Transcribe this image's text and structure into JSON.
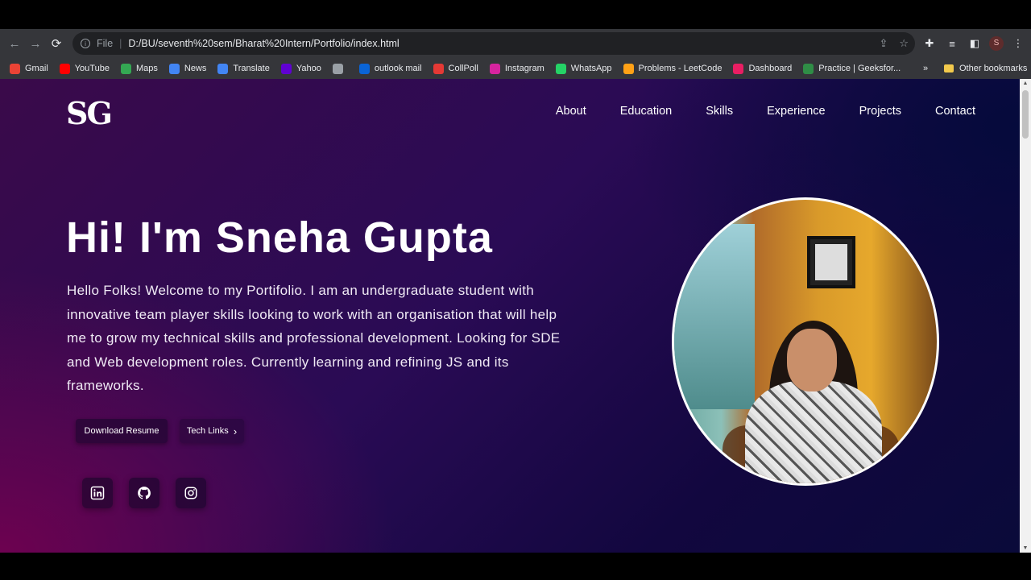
{
  "browser": {
    "url_scheme": "File",
    "url": "D:/BU/seventh%20sem/Bharat%20Intern/Portfolio/index.html",
    "profile_initial": "S",
    "bookmarks": [
      {
        "label": "Gmail",
        "icon": "gmail-icon",
        "color": "#ea4335"
      },
      {
        "label": "YouTube",
        "icon": "youtube-icon",
        "color": "#ff0000"
      },
      {
        "label": "Maps",
        "icon": "maps-icon",
        "color": "#34a853"
      },
      {
        "label": "News",
        "icon": "news-icon",
        "color": "#4285f4"
      },
      {
        "label": "Translate",
        "icon": "translate-icon",
        "color": "#4285f4"
      },
      {
        "label": "Yahoo",
        "icon": "yahoo-icon",
        "color": "#6001d2"
      },
      {
        "label": "",
        "icon": "globe-icon",
        "color": "#9aa0a6"
      },
      {
        "label": "outlook mail",
        "icon": "outlook-icon",
        "color": "#0a64d6"
      },
      {
        "label": "CollPoll",
        "icon": "collpoll-icon",
        "color": "#e53935"
      },
      {
        "label": "Instagram",
        "icon": "instagram-icon",
        "color": "#d6249f"
      },
      {
        "label": "WhatsApp",
        "icon": "whatsapp-icon",
        "color": "#25d366"
      },
      {
        "label": "Problems - LeetCode",
        "icon": "leetcode-icon",
        "color": "#ffa116"
      },
      {
        "label": "Dashboard",
        "icon": "dashboard-icon",
        "color": "#e91e63"
      },
      {
        "label": "Practice | Geeksfor...",
        "icon": "gfg-icon",
        "color": "#2f8d46"
      }
    ],
    "more_bookmarks": "»",
    "other_bookmarks": "Other bookmarks"
  },
  "site": {
    "logo": "SG",
    "nav": [
      "About",
      "Education",
      "Skills",
      "Experience",
      "Projects",
      "Contact"
    ],
    "hero_title": "Hi! I'm Sneha Gupta",
    "hero_text": "Hello Folks! Welcome to my Portifolio. I am an undergraduate student with innovative team player skills looking to work with an organisation that will help me to grow my technical skills and professional development. Looking for SDE and Web development roles. Currently learning and refining JS and its frameworks.",
    "download_button": "Download Resume",
    "tech_button": "Tech Links",
    "socials": [
      "linkedin-icon",
      "github-icon",
      "instagram-icon"
    ]
  }
}
